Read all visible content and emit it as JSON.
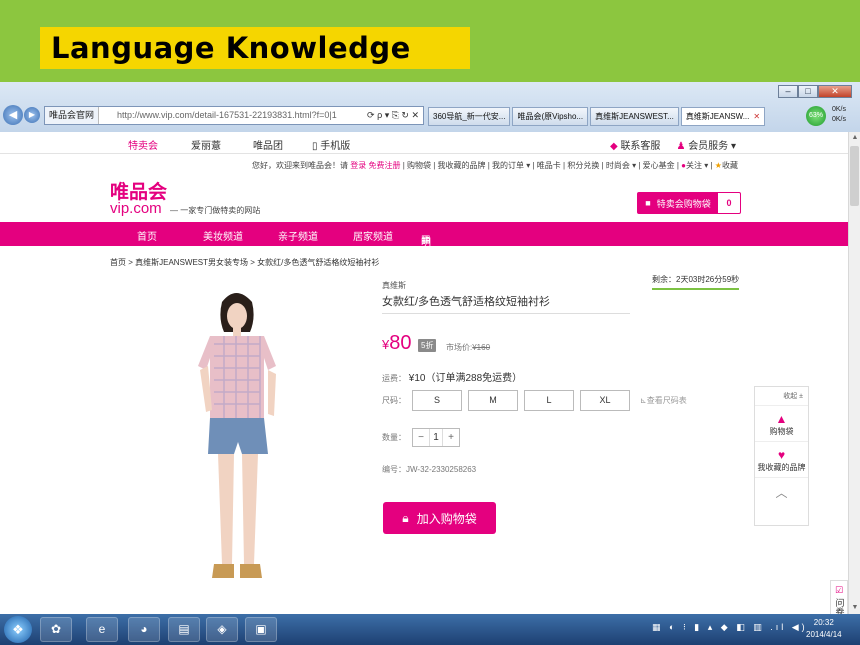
{
  "slide": {
    "title": "Language Knowledge"
  },
  "browser": {
    "site_label": "唯品会官网",
    "url": "http://www.vip.com/detail-167531-22193831.html?f=0|1",
    "tab_1": "360导航_新一代安...",
    "tab_2": "唯品会(原Vipsho...",
    "tab_3": "真维斯JEANSWEST...",
    "tab_4": "真维斯JEANSW...",
    "net_percent": "63%",
    "net_up": "0K/s",
    "net_down": "0K/s"
  },
  "topnav": {
    "item_1": "特卖会",
    "item_2": "爱丽薏",
    "item_3": "唯品团",
    "item_4": "手机版",
    "service": "联系客服",
    "member": "会员服务"
  },
  "userbar": {
    "greeting": "您好，欢迎来到唯品会！请",
    "login": "登录",
    "register": "免费注册",
    "links": "| 购物袋 | 我收藏的品牌 | 我的订单 ▾ | 唯品卡 | 积分兑换 | 时尚会 ▾ | 爱心基金",
    "follow": "关注 ▾",
    "favorite": "收藏"
  },
  "logo": {
    "cn": "唯品会",
    "en": "vip.com",
    "tagline": "一家专门做特卖的网站"
  },
  "cart": {
    "label": "特卖会购物袋",
    "count": "0"
  },
  "mainnav": {
    "home": "首页",
    "beauty": "美妆频道",
    "kids": "亲子频道",
    "home_living": "居家频道",
    "tomorrow": "明天上线"
  },
  "breadcrumb": "首页 > 真维斯JEANSWEST男女装专场 > 女款红/多色透气舒适格纹短袖衬衫",
  "product": {
    "brand": "真维斯",
    "name": "女款红/多色透气舒适格纹短袖衬衫",
    "countdown": "剩余：2天03时26分59秒",
    "currency": "¥",
    "price": "80",
    "discount": "5折",
    "market_label": "市场价:",
    "market_price": "¥160",
    "shipping_label": "运费：",
    "shipping": "¥10（订单满288免运费）",
    "size_label": "尺码：",
    "sizes": [
      "S",
      "M",
      "L",
      "XL"
    ],
    "size_guide": "查看尺码表",
    "qty_label": "数量：",
    "qty_minus": "−",
    "qty": "1",
    "qty_plus": "+",
    "sku_label": "编号：",
    "sku": "JW-32-2330258263",
    "add_to_cart": "加入购物袋"
  },
  "float_panel": {
    "collapse": "收起 ±",
    "cart": "购物袋",
    "brands": "我收藏的品牌"
  },
  "survey": "问卷调查",
  "taskbar": {
    "time": "20:32",
    "date": "2014/4/14"
  },
  "colors": {
    "brand": "#e4007f",
    "slide_bg": "#8cc63f",
    "title_bg": "#f5d600"
  }
}
